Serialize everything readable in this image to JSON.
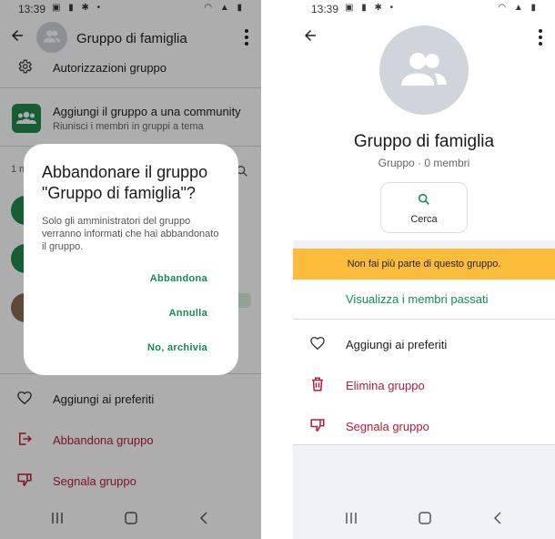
{
  "status_bar": {
    "time": "13:39"
  },
  "left": {
    "header": {
      "title": "Gruppo di famiglia"
    },
    "items": {
      "permissions": "Autorizzazioni gruppo",
      "community_title": "Aggiungi il gruppo a una community",
      "community_sub": "Riunisci i membri in gruppi a tema",
      "members_partial": "1 m",
      "favorites": "Aggiungi ai preferiti",
      "leave": "Abbandona gruppo",
      "report": "Segnala gruppo"
    },
    "dialog": {
      "title": "Abbandonare il gruppo \"Gruppo di famiglia\"?",
      "message": "Solo gli amministratori del gruppo verranno informati che hai abbandonato il gruppo.",
      "btn_leave": "Abbandona",
      "btn_cancel": "Annulla",
      "btn_archive": "No, archivia"
    }
  },
  "right": {
    "group_name": "Gruppo di famiglia",
    "group_meta": "Gruppo · 0 membri",
    "search_label": "Cerca",
    "banner": "Non fai più parte di questo gruppo.",
    "past_members": "Visualizza i membri passati",
    "favorites": "Aggiungi ai preferiti",
    "delete": "Elimina gruppo",
    "report": "Segnala gruppo"
  },
  "colors": {
    "green": "#128c55",
    "red": "#b71c3a",
    "banner": "#fbbc3c",
    "avatar_bg": "#cfd5da"
  },
  "icons": [
    "back-arrow-icon",
    "more-vert-icon",
    "group-avatar-icon",
    "settings-icon",
    "community-icon",
    "search-icon",
    "heart-icon",
    "exit-icon",
    "thumb-down-icon",
    "trash-icon",
    "recent-apps-icon",
    "home-icon",
    "nav-back-icon"
  ]
}
